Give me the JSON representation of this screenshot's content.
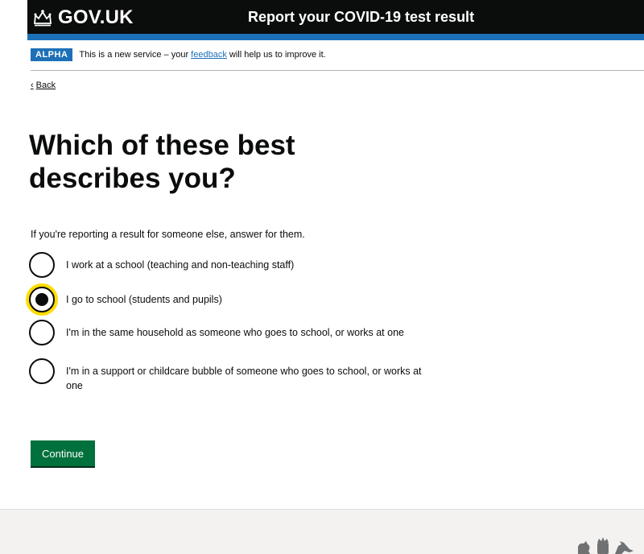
{
  "header": {
    "logo_text": "GOV.UK",
    "service_name": "Report your COVID-19 test result"
  },
  "phase_banner": {
    "tag": "ALPHA",
    "text_before": "This is a new service – your ",
    "link": "feedback",
    "text_after": " will help us to improve it."
  },
  "back_link": "Back",
  "page": {
    "title": "Which of these best describes you?",
    "hint": "If you're reporting a result for someone else, answer for them."
  },
  "radios": [
    {
      "label": "I work at a school (teaching and non-teaching staff)",
      "checked": false
    },
    {
      "label": "I go to school (students and pupils)",
      "checked": true
    },
    {
      "label": "I'm in the same household as someone who goes to school, or works at one",
      "checked": false
    },
    {
      "label": "I'm in a support or childcare bubble of someone who goes to school, or works at one",
      "checked": false
    }
  ],
  "continue_button": "Continue",
  "footer": {
    "crest_icon": "royal-coat-of-arms-icon"
  },
  "colors": {
    "header_bg": "#0b0c0c",
    "header_stripe": "#1d70b8",
    "tag_bg": "#1d70b8",
    "link": "#1d70b8",
    "button_bg": "#00703c",
    "focus": "#ffdd00",
    "footer_bg": "#f3f2f1"
  }
}
